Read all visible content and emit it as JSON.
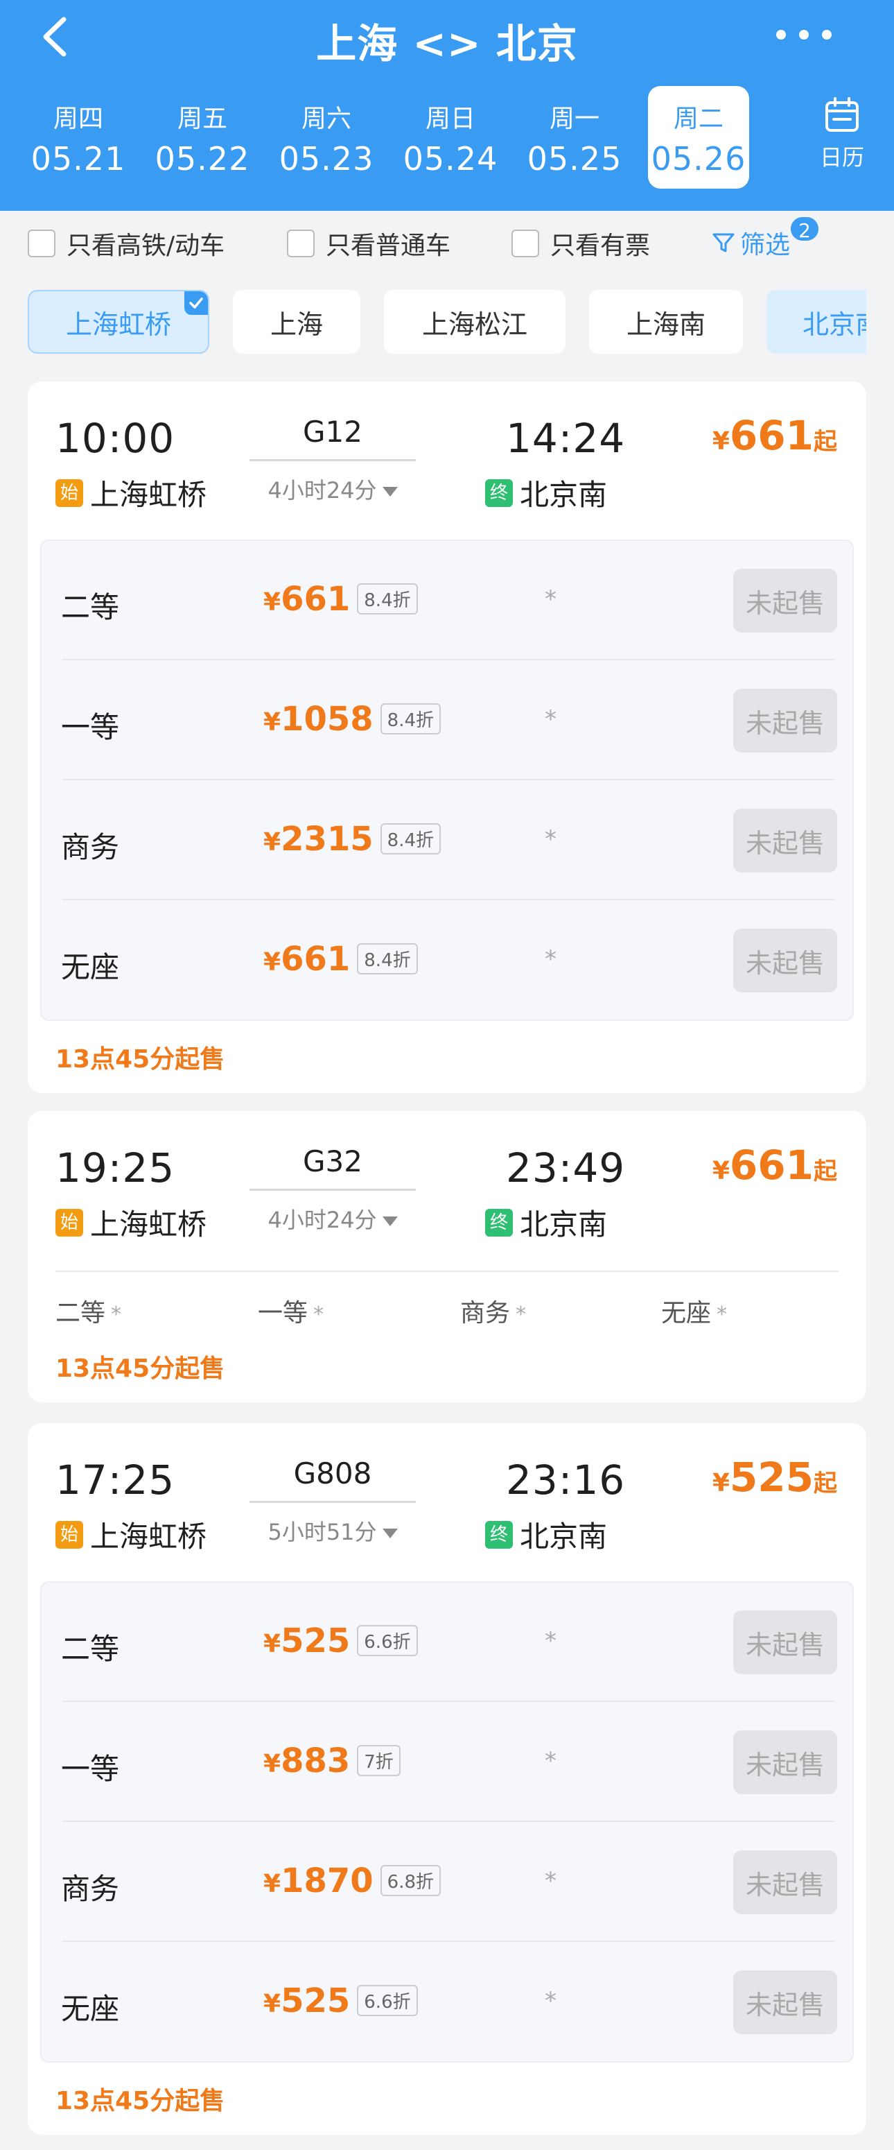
{
  "header": {
    "title": "上海 <> 北京",
    "dates": [
      {
        "weekday": "周四",
        "date": "05.21"
      },
      {
        "weekday": "周五",
        "date": "05.22"
      },
      {
        "weekday": "周六",
        "date": "05.23"
      },
      {
        "weekday": "周日",
        "date": "05.24"
      },
      {
        "weekday": "周一",
        "date": "05.25"
      },
      {
        "weekday": "周二",
        "date": "05.26",
        "selected": true
      }
    ],
    "calendar_label": "日历"
  },
  "filters": {
    "high_speed_only": "只看高铁/动车",
    "normal_only": "只看普通车",
    "available_only": "只看有票",
    "screen_label": "筛选",
    "screen_count": "2"
  },
  "stations": [
    {
      "name": "上海虹桥",
      "selected": true
    },
    {
      "name": "上海"
    },
    {
      "name": "上海松江"
    },
    {
      "name": "上海南"
    },
    {
      "name": "北京南"
    }
  ],
  "labels": {
    "start_tag": "始",
    "end_tag": "终",
    "yen": "¥",
    "from_suffix": "起",
    "not_on_sale": "未起售",
    "star": "*"
  },
  "trains": [
    {
      "dep_time": "10:00",
      "dep_station": "上海虹桥",
      "train_no": "G12",
      "duration": "4小时24分",
      "arr_time": "14:24",
      "arr_station": "北京南",
      "min_price": "661",
      "seats": [
        {
          "name": "二等",
          "price": "661",
          "discount": "8.4折"
        },
        {
          "name": "一等",
          "price": "1058",
          "discount": "8.4折"
        },
        {
          "name": "商务",
          "price": "2315",
          "discount": "8.4折"
        },
        {
          "name": "无座",
          "price": "661",
          "discount": "8.4折"
        }
      ],
      "sale_time": "13点45分起售"
    },
    {
      "dep_time": "19:25",
      "dep_station": "上海虹桥",
      "train_no": "G32",
      "duration": "4小时24分",
      "arr_time": "23:49",
      "arr_station": "北京南",
      "min_price": "661",
      "seat_summary": [
        "二等",
        "一等",
        "商务",
        "无座"
      ],
      "sale_time": "13点45分起售"
    },
    {
      "dep_time": "17:25",
      "dep_station": "上海虹桥",
      "train_no": "G808",
      "duration": "5小时51分",
      "arr_time": "23:16",
      "arr_station": "北京南",
      "min_price": "525",
      "seats": [
        {
          "name": "二等",
          "price": "525",
          "discount": "6.6折"
        },
        {
          "name": "一等",
          "price": "883",
          "discount": "7折"
        },
        {
          "name": "商务",
          "price": "1870",
          "discount": "6.8折"
        },
        {
          "name": "无座",
          "price": "525",
          "discount": "6.6折"
        }
      ],
      "sale_time": "13点45分起售"
    }
  ],
  "colors": {
    "primary": "#3a9bf2",
    "price": "#f07a1a",
    "start_tag": "#f39c12",
    "end_tag": "#2ebf73"
  }
}
